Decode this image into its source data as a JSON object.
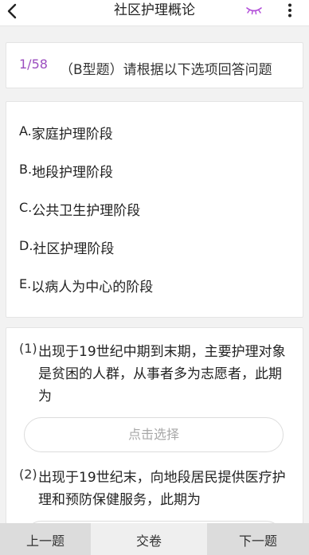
{
  "header": {
    "title": "社区护理概论",
    "back_icon": "chevron-left-icon",
    "eye_icon": "closed-eye-icon",
    "more_icon": "more-vertical-icon",
    "accent_color": "#b04ad8"
  },
  "question": {
    "progress": "1/58",
    "type_text": "（B型题）请根据以下选项回答问题"
  },
  "options": [
    {
      "letter": "A.",
      "text": "家庭护理阶段"
    },
    {
      "letter": "B.",
      "text": "地段护理阶段"
    },
    {
      "letter": "C.",
      "text": "公共卫生护理阶段"
    },
    {
      "letter": "D.",
      "text": "社区护理阶段"
    },
    {
      "letter": "E.",
      "text": "以病人为中心的阶段"
    }
  ],
  "sub_questions": [
    {
      "number": "(1)",
      "text": "出现于19世纪中期到末期，主要护理对象是贫困的人群，从事者多为志愿者，此期为",
      "select_label": "点击选择"
    },
    {
      "number": "(2)",
      "text": "出现于19世纪末，向地段居民提供医疗护理和预防保健服务，此期为"
    }
  ],
  "footer": {
    "prev_label": "上一题",
    "submit_label": "交卷",
    "next_label": "下一题"
  }
}
